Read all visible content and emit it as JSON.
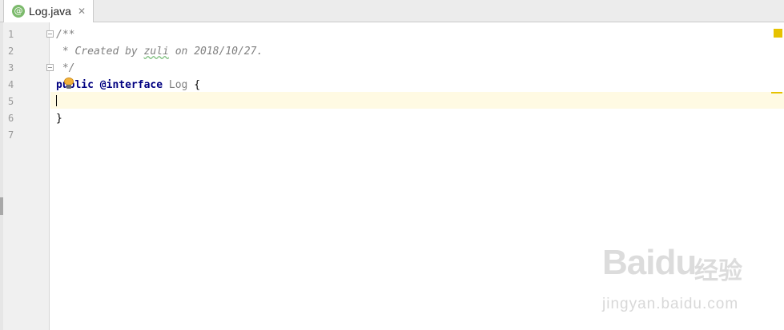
{
  "tab": {
    "icon": "annotation-icon",
    "icon_glyph": "@",
    "label": "Log.java",
    "close_glyph": "✕"
  },
  "gutter": {
    "line_numbers": [
      "1",
      "2",
      "3",
      "4",
      "5",
      "6",
      "7"
    ]
  },
  "code": {
    "l1": "/**",
    "l2_prefix": " * Created by ",
    "l2_user": "zuli",
    "l2_suffix": " on 2018/10/27.",
    "l3": " */",
    "l4_kw": "public",
    "l4_ann": "@interface",
    "l4_name": "Log",
    "l4_brace": "{",
    "l6": "}"
  },
  "watermark": {
    "logo": "Baidu",
    "cn": "经验",
    "url": "jingyan.baidu.com"
  },
  "colors": {
    "keyword": "#000080",
    "comment": "#808080",
    "current_line": "#fffae3",
    "warning_marker": "#e6c200",
    "gutter_bg": "#f0f0f0"
  }
}
